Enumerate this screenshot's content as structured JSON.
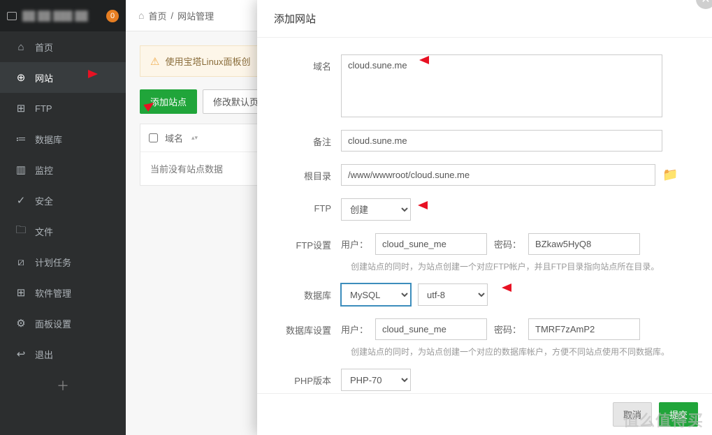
{
  "logo": {
    "badge": "0"
  },
  "sidebar": [
    {
      "icon": "⌂",
      "label": "首页"
    },
    {
      "icon": "⊕",
      "label": "网站",
      "active": true
    },
    {
      "icon": "⊞",
      "label": "FTP"
    },
    {
      "icon": "≔",
      "label": "数据库"
    },
    {
      "icon": "▥",
      "label": "监控"
    },
    {
      "icon": "✓",
      "label": "安全"
    },
    {
      "icon": "🗀",
      "label": "文件"
    },
    {
      "icon": "⧄",
      "label": "计划任务"
    },
    {
      "icon": "⊞",
      "label": "软件管理"
    },
    {
      "icon": "⚙",
      "label": "面板设置"
    },
    {
      "icon": "↩",
      "label": "退出"
    }
  ],
  "breadcrumb": {
    "home": "⌂",
    "p1": "首页",
    "sep": "/",
    "p2": "网站管理"
  },
  "alert": "使用宝塔Linux面板创",
  "buttons": {
    "add": "添加站点",
    "default": "修改默认页"
  },
  "table": {
    "col1": "域名",
    "sort": "▲▼",
    "empty": "当前没有站点数据"
  },
  "modal": {
    "title": "添加网站",
    "labels": {
      "domain": "域名",
      "remark": "备注",
      "root": "根目录",
      "ftp": "FTP",
      "ftpset": "FTP设置",
      "db": "数据库",
      "dbset": "数据库设置",
      "php": "PHP版本",
      "user": "用户：",
      "pass": "密码："
    },
    "domain": "cloud.sune.me",
    "remark": "cloud.sune.me",
    "root": "/www/wwwroot/cloud.sune.me",
    "ftp_sel": "创建",
    "ftp_user": "cloud_sune_me",
    "ftp_pass": "BZkaw5HyQ8",
    "ftp_hint": "创建站点的同时，为站点创建一个对应FTP帐户，并且FTP目录指向站点所在目录。",
    "db_sel": "MySQL",
    "db_charset": "utf-8",
    "db_user": "cloud_sune_me",
    "db_pass": "TMRF7zAmP2",
    "db_hint": "创建站点的同时，为站点创建一个对应的数据库帐户，方便不同站点使用不同数据库。",
    "php_sel": "PHP-70",
    "footer": {
      "cancel": "取消",
      "submit": "提交"
    }
  },
  "watermark": "值么值得买"
}
